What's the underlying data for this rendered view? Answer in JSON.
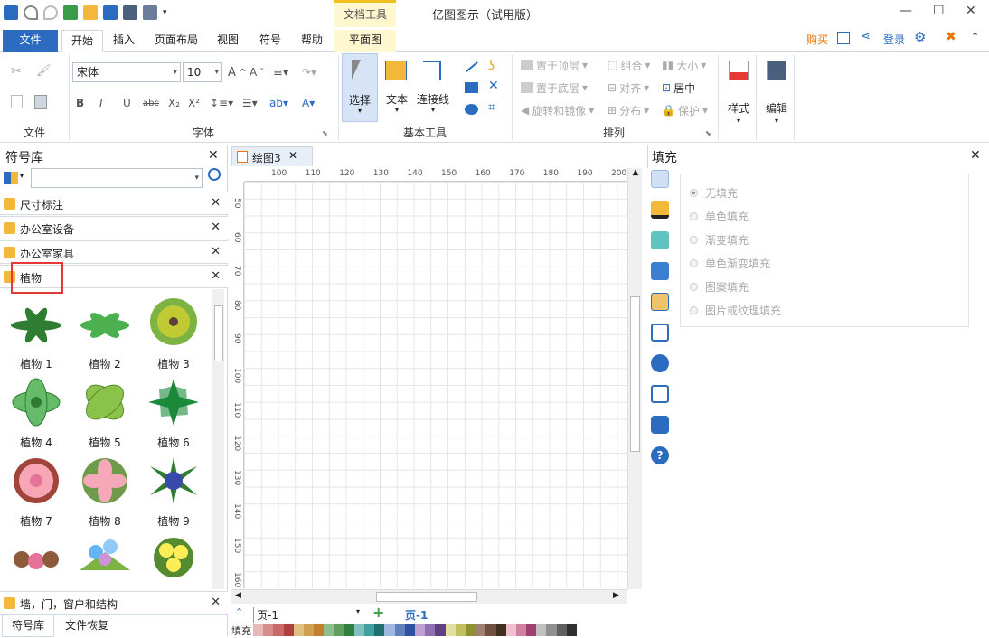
{
  "window": {
    "title": "亿图图示（试用版）",
    "context_tab_group": "文档工具"
  },
  "tabs": [
    {
      "label": "文件"
    },
    {
      "label": "开始"
    },
    {
      "label": "插入"
    },
    {
      "label": "页面布局"
    },
    {
      "label": "视图"
    },
    {
      "label": "符号"
    },
    {
      "label": "帮助"
    },
    {
      "label": "平面图"
    }
  ],
  "top_right": {
    "buy": "购买",
    "login": "登录"
  },
  "ribbon": {
    "file_group": "文件",
    "font_group": "字体",
    "font_name": "宋体",
    "font_size": "10",
    "basic_tools_group": "基本工具",
    "select": "选择",
    "text": "文本",
    "connector": "连接线",
    "arrange_group": "排列",
    "bring_front": "置于顶层",
    "send_back": "置于底层",
    "rotate_mirror": "旋转和镜像",
    "group": "组合",
    "align": "对齐",
    "distribute": "分布",
    "size": "大小",
    "center": "居中",
    "protect": "保护",
    "style": "样式",
    "edit": "编辑"
  },
  "library": {
    "title": "符号库",
    "categories": [
      "尺寸标注",
      "办公室设备",
      "办公室家具",
      "植物"
    ],
    "symbols": [
      "植物 1",
      "植物 2",
      "植物 3",
      "植物 4",
      "植物 5",
      "植物 6",
      "植物 7",
      "植物 8",
      "植物 9"
    ],
    "bottom_category": "墙，门，窗户和结构",
    "bottom_tabs": [
      "符号库",
      "文件恢复"
    ]
  },
  "document": {
    "tab": "绘图3",
    "ruler_h": [
      "100",
      "110",
      "120",
      "130",
      "140",
      "150",
      "160",
      "170",
      "180",
      "190",
      "200"
    ],
    "ruler_v": [
      "50",
      "60",
      "70",
      "80",
      "90",
      "100",
      "110",
      "120",
      "130",
      "140",
      "150",
      "160"
    ],
    "page_select": "页-1",
    "page_tab": "页-1",
    "fill_label": "填充"
  },
  "fill_panel": {
    "title": "填充",
    "options": [
      "无填充",
      "单色填充",
      "渐变填充",
      "单色渐变填充",
      "图案填充",
      "图片或纹理填充"
    ],
    "selected": "无填充"
  },
  "colors": {
    "file_tab": "#2b6bc0",
    "accent_blue": "#2b6bc0",
    "highlight_red": "#e53935",
    "buy_orange": "#e8740c"
  }
}
